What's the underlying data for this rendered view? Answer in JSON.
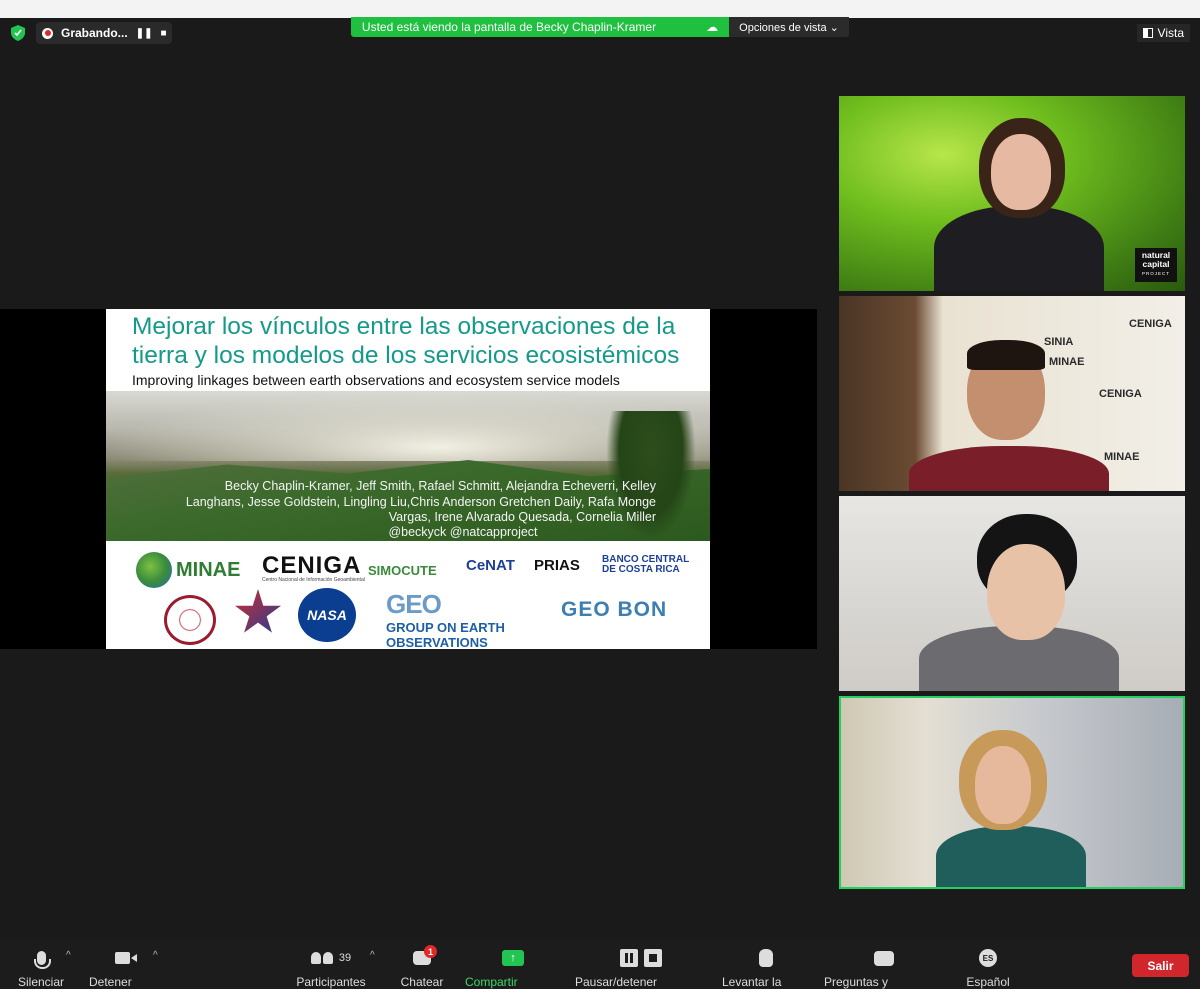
{
  "recording": {
    "label": "Grabando...",
    "pause_icon": "pause-icon",
    "stop_icon": "stop-icon"
  },
  "banner": {
    "text": "Usted está viendo la pantalla de Becky Chaplin-Kramer",
    "view_options": "Opciones de vista ⌄"
  },
  "view_button": {
    "label": "Vista"
  },
  "slide": {
    "title": "Mejorar los vínculos entre las observaciones de la tierra y los modelos de los servicios ecosistémicos",
    "subtitle": "Improving linkages between earth observations and ecosystem service models",
    "authors": "Becky Chaplin-Kramer, Jeff Smith, Rafael Schmitt, Alejandra Echeverri, Kelley Langhans, Jesse Goldstein, Lingling Liu,Chris Anderson  Gretchen Daily, Rafa Monge Vargas, Irene Alvarado Quesada, Cornelia Miller",
    "handles": "@beckyck @natcapproject",
    "logos": {
      "minae": "MINAE",
      "ceniga": "CENIGA",
      "ceniga_sub": "Centro Nacional de Información Geoambiental",
      "simocute": "SIMOCUTE",
      "cenat": "CeNAT",
      "prias": "PRIAS",
      "bccr": "BANCO CENTRAL DE COSTA RICA",
      "nasa": "NASA",
      "geo_mark": "GEO",
      "geo_text": "GROUP ON EARTH OBSERVATIONS",
      "geobon": "GEO BON"
    }
  },
  "participants_tiles": [
    {
      "badge_line1": "natural",
      "badge_line2": "capital",
      "badge_line3": "PROJECT"
    },
    {
      "wall_logos": [
        "CENIGA",
        "SINIA",
        "MINAE"
      ]
    },
    {},
    {
      "active_speaker": true
    }
  ],
  "toolbar": {
    "mute": "Silenciar",
    "video": "Detener video",
    "participants": "Participantes",
    "participants_count": "39",
    "chat": "Chatear",
    "chat_badge": "1",
    "share": "Compartir pantalla",
    "record": "Pausar/detener grabación",
    "raise_hand": "Levantar la mano",
    "qa": "Preguntas y respuestas",
    "language": "Español",
    "language_code": "ES",
    "leave": "Salir"
  },
  "colors": {
    "share_green": "#1fbf40",
    "leave_red": "#d0262c",
    "slide_title": "#159a8a",
    "active_border": "#23d160"
  }
}
